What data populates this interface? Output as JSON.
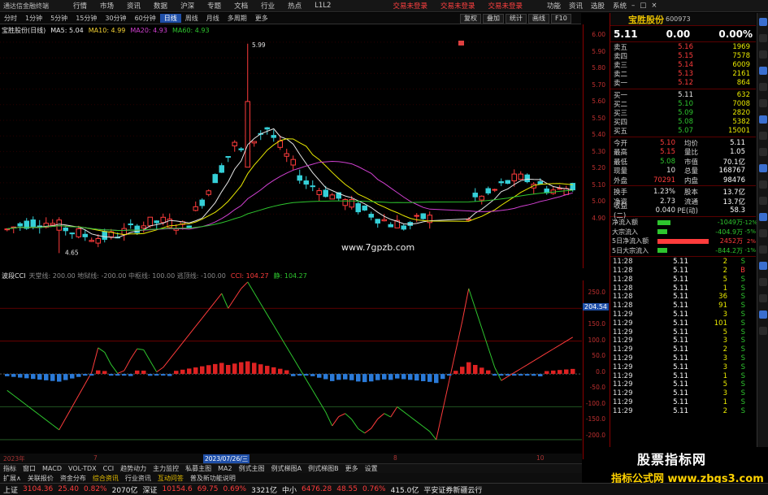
{
  "app": {
    "title": "通达信金融终端",
    "menu": [
      "行情",
      "市场",
      "资讯",
      "数据",
      "沪深",
      "专题",
      "文档",
      "行业",
      "热点",
      "L1L2"
    ],
    "warn": "交易未登录",
    "right_menu": [
      "功能",
      "资讯",
      "选股",
      "系统"
    ]
  },
  "periods": [
    {
      "label": "分时",
      "active": false
    },
    {
      "label": "1分钟",
      "active": false
    },
    {
      "label": "5分钟",
      "active": false
    },
    {
      "label": "15分钟",
      "active": false
    },
    {
      "label": "30分钟",
      "active": false
    },
    {
      "label": "60分钟",
      "active": false
    },
    {
      "label": "日线",
      "active": true
    },
    {
      "label": "周线",
      "active": false
    },
    {
      "label": "月线",
      "active": false
    },
    {
      "label": "多周期",
      "active": false
    },
    {
      "label": "更多",
      "active": false
    }
  ],
  "right_tools": [
    "复权",
    "叠加",
    "统计",
    "画线",
    "F10"
  ],
  "main_chart": {
    "stock_label": "宝胜股份(日线)",
    "ma5": "MA5: 5.04",
    "ma10": "MA10: 4.99",
    "ma20": "MA20: 4.93",
    "ma60": "MA60: 4.93",
    "high_marker": "5.99",
    "low_marker": "4.65",
    "watermark": "www.7gpzb.com",
    "price_ticks": [
      "6.00",
      "5.90",
      "5.80",
      "5.70",
      "5.60",
      "5.50",
      "5.40",
      "5.30",
      "5.20",
      "5.10",
      "5.00",
      "4.90"
    ],
    "colors": {
      "up": "#ff3c3c",
      "down": "#35d0d8",
      "ma5": "#e6e6e6",
      "ma10": "#e8e800",
      "ma20": "#d040d0",
      "ma60": "#2ec52e"
    }
  },
  "cci_panel": {
    "title": "波段CCI",
    "params": "天堂线: 200.00  地狱线: -200.00  中枢线: 100.00  逃顶线: -100.00",
    "cci_value": "CCI: 104.27",
    "jing_value": "静: 104.27",
    "badge": "204.54",
    "ticks": [
      "250.0",
      "200.0",
      "150.0",
      "100.0",
      "50.0",
      "0.0",
      "-50.0",
      "-100.0",
      "-150.0",
      "-200.0"
    ]
  },
  "datebar": {
    "left": "2023年",
    "mid": "7",
    "selected": "2023/07/26/三",
    "m8": "8",
    "m9": "9",
    "m10": "10"
  },
  "tabs": [
    "指标",
    "窗口",
    "MACD",
    "VOL-TDX",
    "CCI",
    "趋势动力",
    "主力监控",
    "私募主图",
    "MA2",
    "例式主图",
    "例式梯图A",
    "例式梯图B",
    "更多",
    "设置"
  ],
  "toolbar2": [
    "扩展∧",
    "关联报价",
    "资金分布",
    "综合资讯",
    "行业资讯",
    "互动问答",
    "普及新功能说明"
  ],
  "quote": {
    "name": "宝胜股份",
    "code": "600973",
    "price": "5.11",
    "change": "0.00",
    "pct": "0.00%",
    "sells": [
      {
        "label": "卖五",
        "price": "5.16",
        "vol": "1969"
      },
      {
        "label": "卖四",
        "price": "5.15",
        "vol": "7578"
      },
      {
        "label": "卖三",
        "price": "5.14",
        "vol": "6009"
      },
      {
        "label": "卖二",
        "price": "5.13",
        "vol": "2161"
      },
      {
        "label": "卖一",
        "price": "5.12",
        "vol": "864"
      }
    ],
    "buys": [
      {
        "label": "买一",
        "price": "5.11",
        "vol": "632"
      },
      {
        "label": "买二",
        "price": "5.10",
        "vol": "7008"
      },
      {
        "label": "买三",
        "price": "5.09",
        "vol": "2820"
      },
      {
        "label": "买四",
        "price": "5.08",
        "vol": "5382"
      },
      {
        "label": "买五",
        "price": "5.07",
        "vol": "15001"
      }
    ],
    "stats": [
      {
        "a": "今开",
        "b": "5.10",
        "bc": "red",
        "c": "均价",
        "d": "5.11",
        "dc": "red"
      },
      {
        "a": "最高",
        "b": "5.15",
        "bc": "red",
        "c": "量比",
        "d": "1.05",
        "dc": "red"
      },
      {
        "a": "最低",
        "b": "5.08",
        "bc": "green",
        "c": "市值",
        "d": "70.1亿",
        "dc": "white"
      },
      {
        "a": "现量",
        "b": "10",
        "bc": "white",
        "c": "总量",
        "d": "168767",
        "dc": "white"
      },
      {
        "a": "外盘",
        "b": "70291",
        "bc": "red",
        "c": "内盘",
        "d": "98476",
        "dc": "green"
      },
      {
        "a": "换手",
        "b": "1.23%",
        "bc": "white",
        "c": "股本",
        "d": "13.7亿",
        "dc": "white"
      },
      {
        "a": "净资",
        "b": "2.73",
        "bc": "white",
        "c": "流通",
        "d": "13.7亿",
        "dc": "white"
      },
      {
        "a": "收益(二)",
        "b": "0.040",
        "bc": "white",
        "c": "PE(动)",
        "d": "58.3",
        "dc": "white"
      }
    ],
    "flows": [
      {
        "label": "净流入额",
        "value": "-1049万",
        "pct": "-12%",
        "color": "green",
        "bar": 0.25
      },
      {
        "label": "大宗流入",
        "value": "-404.9万",
        "pct": "-5%",
        "color": "green",
        "bar": 0.2
      },
      {
        "label": "5日净流入额",
        "value": "2452万",
        "pct": "2%",
        "color": "red",
        "bar": 1.0
      },
      {
        "label": "5日大宗流入",
        "value": "-844.2万",
        "pct": "-1%",
        "color": "green",
        "bar": 0.2
      }
    ],
    "ticks": [
      {
        "t": "11:28",
        "p": "5.11",
        "v": "2",
        "d": "S"
      },
      {
        "t": "11:28",
        "p": "5.11",
        "v": "2",
        "d": "B"
      },
      {
        "t": "11:28",
        "p": "5.11",
        "v": "5",
        "d": "S"
      },
      {
        "t": "11:28",
        "p": "5.11",
        "v": "1",
        "d": "S"
      },
      {
        "t": "11:28",
        "p": "5.11",
        "v": "36",
        "d": "S"
      },
      {
        "t": "11:28",
        "p": "5.11",
        "v": "91",
        "d": "S"
      },
      {
        "t": "11:29",
        "p": "5.11",
        "v": "3",
        "d": "S"
      },
      {
        "t": "11:29",
        "p": "5.11",
        "v": "101",
        "d": "S"
      },
      {
        "t": "11:29",
        "p": "5.11",
        "v": "5",
        "d": "S"
      },
      {
        "t": "11:29",
        "p": "5.11",
        "v": "3",
        "d": "S"
      },
      {
        "t": "11:29",
        "p": "5.11",
        "v": "2",
        "d": "S"
      },
      {
        "t": "11:29",
        "p": "5.11",
        "v": "3",
        "d": "S"
      },
      {
        "t": "11:29",
        "p": "5.11",
        "v": "3",
        "d": "S"
      },
      {
        "t": "11:29",
        "p": "5.11",
        "v": "1",
        "d": "S"
      },
      {
        "t": "11:29",
        "p": "5.11",
        "v": "5",
        "d": "S"
      },
      {
        "t": "11:29",
        "p": "5.11",
        "v": "3",
        "d": "S"
      },
      {
        "t": "11:29",
        "p": "5.11",
        "v": "1",
        "d": "S"
      },
      {
        "t": "11:29",
        "p": "5.11",
        "v": "2",
        "d": "S"
      }
    ],
    "ticks_title": "笔"
  },
  "statusbar": [
    {
      "text": "上证",
      "c": "white"
    },
    {
      "text": "3104.36",
      "c": "red"
    },
    {
      "text": "25.40",
      "c": "red"
    },
    {
      "text": "0.82%",
      "c": "red"
    },
    {
      "text": "2070亿",
      "c": "white"
    },
    {
      "text": "深证",
      "c": "white"
    },
    {
      "text": "10154.6",
      "c": "red"
    },
    {
      "text": "69.75",
      "c": "red"
    },
    {
      "text": "0.69%",
      "c": "red"
    },
    {
      "text": "3321亿",
      "c": "white"
    },
    {
      "text": "中小",
      "c": "white"
    },
    {
      "text": "6476.28",
      "c": "red"
    },
    {
      "text": "48.55",
      "c": "red"
    },
    {
      "text": "0.76%",
      "c": "red"
    },
    {
      "text": "415.0亿",
      "c": "white"
    },
    {
      "text": "平安证券新疆云行",
      "c": "white"
    }
  ],
  "promo": {
    "line1": "股票指标网",
    "line2": "指标公式网 www.zbgs3.com"
  },
  "clock": "12:34:03 周五"
}
